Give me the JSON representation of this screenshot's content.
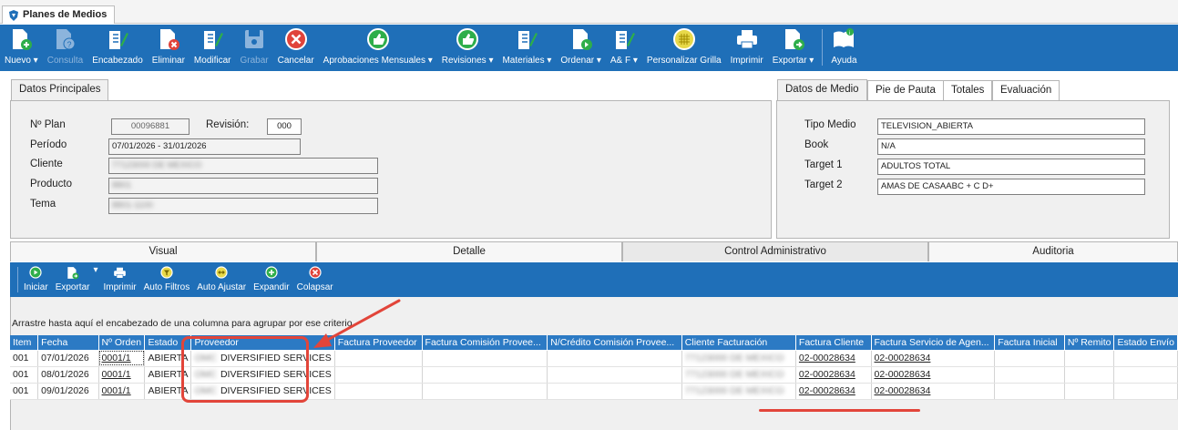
{
  "window_tab": {
    "title": "Planes de Medios"
  },
  "toolbar": {
    "buttons": [
      {
        "label": "Nuevo",
        "dropdown": true,
        "icon": "new-document-icon",
        "disabled": false
      },
      {
        "label": "Consulta",
        "dropdown": false,
        "icon": "query-icon",
        "disabled": true
      },
      {
        "label": "Encabezado",
        "dropdown": false,
        "icon": "edit-header-icon",
        "disabled": false
      },
      {
        "label": "Eliminar",
        "dropdown": false,
        "icon": "delete-document-icon",
        "disabled": false
      },
      {
        "label": "Modificar",
        "dropdown": false,
        "icon": "edit-icon",
        "disabled": false
      },
      {
        "label": "Grabar",
        "dropdown": false,
        "icon": "save-icon",
        "disabled": true
      },
      {
        "label": "Cancelar",
        "dropdown": false,
        "icon": "cancel-icon",
        "disabled": false
      },
      {
        "label": "Aprobaciones Mensuales",
        "dropdown": true,
        "icon": "thumbs-up-icon",
        "disabled": false
      },
      {
        "label": "Revisiones",
        "dropdown": true,
        "icon": "thumbs-up-icon",
        "disabled": false
      },
      {
        "label": "Materiales",
        "dropdown": true,
        "icon": "edit-icon",
        "disabled": false
      },
      {
        "label": "Ordenar",
        "dropdown": true,
        "icon": "order-icon",
        "disabled": false
      },
      {
        "label": "A& F",
        "dropdown": true,
        "icon": "edit-icon",
        "disabled": false
      },
      {
        "label": "Personalizar Grilla",
        "dropdown": false,
        "icon": "grid-icon",
        "disabled": false
      },
      {
        "label": "Imprimir",
        "dropdown": false,
        "icon": "print-icon",
        "disabled": false
      },
      {
        "label": "Exportar",
        "dropdown": true,
        "icon": "export-icon",
        "disabled": false
      },
      {
        "label": "Ayuda",
        "dropdown": false,
        "icon": "help-book-icon",
        "disabled": false
      }
    ]
  },
  "datos_principales": {
    "tab_label": "Datos Principales",
    "nro_plan_label": "Nº Plan",
    "nro_plan_value": "00096881",
    "revision_label": "Revisión:",
    "revision_value": "000",
    "periodo_label": "Período",
    "periodo_value": "07/01/2026 - 31/01/2026",
    "cliente_label": "Cliente",
    "cliente_value": "77123000 DE MEXICO",
    "producto_label": "Producto",
    "producto_value": "8801",
    "tema_label": "Tema",
    "tema_value": "8801-1100"
  },
  "right_panel": {
    "tabs": [
      "Datos de Medio",
      "Pie de Pauta",
      "Totales",
      "Evaluación"
    ],
    "tipo_medio_label": "Tipo Medio",
    "tipo_medio_value": "TELEVISION_ABIERTA",
    "book_label": "Book",
    "book_value": "N/A",
    "target1_label": "Target 1",
    "target1_value": "ADULTOS TOTAL",
    "target2_label": "Target 2",
    "target2_value": "AMAS DE CASAABC + C D+"
  },
  "section_tabs": [
    "Visual",
    "Detalle",
    "Control Administrativo",
    "Auditoria"
  ],
  "toolbar2": {
    "buttons": [
      {
        "label": "Iniciar",
        "icon": "play-icon"
      },
      {
        "label": "Exportar",
        "icon": "export-icon"
      },
      {
        "label": "Imprimir",
        "icon": "print-icon"
      },
      {
        "label": "Auto Filtros",
        "icon": "filter-icon"
      },
      {
        "label": "Auto Ajustar",
        "icon": "autofit-icon"
      },
      {
        "label": "Expandir",
        "icon": "expand-icon"
      },
      {
        "label": "Colapsar",
        "icon": "collapse-icon"
      }
    ]
  },
  "group_hint": "Arrastre hasta aquí el encabezado de una columna para agrupar por ese criterio",
  "grid": {
    "columns": [
      "Item",
      "Fecha",
      "Nº Orden",
      "Estado",
      "Proveedor",
      "Factura Proveedor",
      "Factura Comisión Provee...",
      "N/Crédito Comisión Provee...",
      "Cliente Facturación",
      "Factura Cliente",
      "Factura Servicio de Agen...",
      "Factura Inicial",
      "Nº Remito",
      "Estado Envío"
    ],
    "rows": [
      {
        "item": "001",
        "fecha": "07/01/2026",
        "orden": "0001/1",
        "estado": "ABIERTA",
        "proveedor_prefix": "OMC",
        "proveedor": "DIVERSIFIED SERVICES",
        "cliente_fact": "77123000 DE MEXICO",
        "factura_cliente": "02-00028634",
        "factura_servicio": "02-00028634"
      },
      {
        "item": "001",
        "fecha": "08/01/2026",
        "orden": "0001/1",
        "estado": "ABIERTA",
        "proveedor_prefix": "OMC",
        "proveedor": "DIVERSIFIED SERVICES",
        "cliente_fact": "77123000 DE MEXICO",
        "factura_cliente": "02-00028634",
        "factura_servicio": "02-00028634"
      },
      {
        "item": "001",
        "fecha": "09/01/2026",
        "orden": "0001/1",
        "estado": "ABIERTA",
        "proveedor_prefix": "OMC",
        "proveedor": "DIVERSIFIED SERVICES",
        "cliente_fact": "77123000 DE MEXICO",
        "factura_cliente": "02-00028634",
        "factura_servicio": "02-00028634"
      }
    ]
  },
  "colors": {
    "toolbar_blue": "#1f6fb8",
    "grid_header_blue": "#2c7ac4",
    "annotation_red": "#e2453a"
  }
}
